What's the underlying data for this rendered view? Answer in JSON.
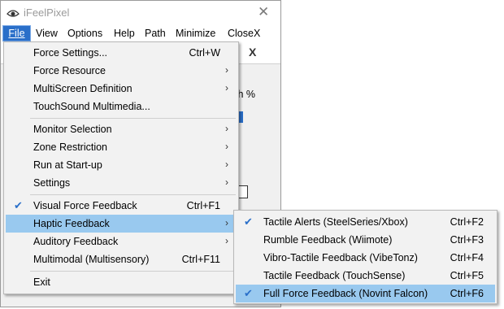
{
  "window": {
    "title": "iFeelPixel",
    "close_glyph": "✕"
  },
  "menubar": {
    "file": "File",
    "view": "View",
    "options": "Options",
    "help": "Help",
    "path": "Path",
    "minimize": "Minimize",
    "closex": "CloseX"
  },
  "background": {
    "panel_label": "th %"
  },
  "file_menu": {
    "items": [
      {
        "label": "Force Settings...",
        "shortcut": "Ctrl+W"
      },
      {
        "label": "Force Resource",
        "submenu": true
      },
      {
        "label": "MultiScreen Definition",
        "submenu": true
      },
      {
        "label": "TouchSound Multimedia..."
      },
      {
        "label": "Monitor Selection",
        "submenu": true
      },
      {
        "label": "Zone Restriction",
        "submenu": true
      },
      {
        "label": "Run at Start-up",
        "submenu": true
      },
      {
        "label": "Settings",
        "submenu": true
      },
      {
        "label": "Visual Force Feedback",
        "shortcut": "Ctrl+F1",
        "checked": true
      },
      {
        "label": "Haptic Feedback",
        "submenu": true,
        "highlighted": true
      },
      {
        "label": "Auditory Feedback",
        "submenu": true
      },
      {
        "label": "Multimodal (Multisensory)",
        "shortcut": "Ctrl+F11"
      },
      {
        "label": "Exit"
      }
    ]
  },
  "haptic_submenu": {
    "items": [
      {
        "label": "Tactile Alerts (SteelSeries/Xbox)",
        "shortcut": "Ctrl+F2",
        "checked": true
      },
      {
        "label": "Rumble Feedback (Wiimote)",
        "shortcut": "Ctrl+F3"
      },
      {
        "label": "Vibro-Tactile Feedback (VibeTonz)",
        "shortcut": "Ctrl+F4"
      },
      {
        "label": "Tactile Feedback (TouchSense)",
        "shortcut": "Ctrl+F5"
      },
      {
        "label": "Full Force Feedback (Novint Falcon)",
        "shortcut": "Ctrl+F6",
        "checked": true,
        "highlighted": true
      }
    ]
  },
  "glyphs": {
    "check": "✔",
    "arrow": "›"
  },
  "colors": {
    "accent": "#2a6fc9",
    "highlight": "#99c9ef"
  }
}
